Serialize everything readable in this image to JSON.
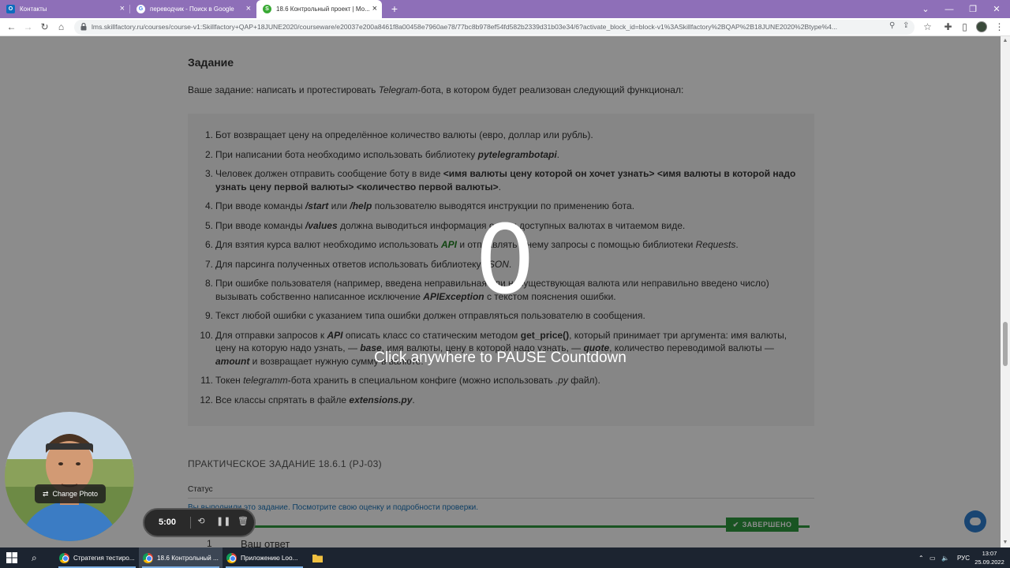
{
  "browser": {
    "tabs": [
      {
        "label": "Контакты",
        "icon": "outlook-icon"
      },
      {
        "label": "переводчик - Поиск в Google",
        "icon": "google-icon"
      },
      {
        "label": "18.6 Контрольный проект | Мо...",
        "icon": "skillfactory-icon"
      }
    ],
    "new_tab_label": "+",
    "url": "lms.skillfactory.ru/courses/course-v1:Skillfactory+QAP+18JUNE2020/courseware/e20037e200a8461f8a00458e7960ae78/77bc8b978ef54fd582b2339d31b03e34/6?activate_block_id=block-v1%3ASkillfactory%2BQAP%2B18JUNE2020%2Btype%4..."
  },
  "content": {
    "heading": "Задание",
    "intro_before": "Ваше задание: написать и протестировать ",
    "intro_italic": "Telegram",
    "intro_after": "-бота, в котором будет реализован следующий функционал:",
    "items": [
      {
        "num": "1.",
        "parts": [
          {
            "t": "Бот возвращает цену на определённое количество валюты (евро, доллар или рубль).",
            "s": ""
          }
        ]
      },
      {
        "num": "2.",
        "parts": [
          {
            "t": "При написании бота необходимо использовать библиотеку ",
            "s": ""
          },
          {
            "t": "pytelegrambotapi",
            "s": "bi"
          },
          {
            "t": ".",
            "s": ""
          }
        ]
      },
      {
        "num": "3.",
        "parts": [
          {
            "t": "Человек должен отправить сообщение боту в виде ",
            "s": ""
          },
          {
            "t": "<имя валюты цену которой он хочет узнать> <имя валюты в которой надо узнать цену первой валюты> <количество первой валюты>",
            "s": "b"
          },
          {
            "t": ".",
            "s": ""
          }
        ]
      },
      {
        "num": "4.",
        "parts": [
          {
            "t": "При вводе команды ",
            "s": ""
          },
          {
            "t": "/start",
            "s": "bi"
          },
          {
            "t": " или ",
            "s": ""
          },
          {
            "t": "/help",
            "s": "bi"
          },
          {
            "t": " пользователю выводятся инструкции по применению бота.",
            "s": ""
          }
        ]
      },
      {
        "num": "5.",
        "parts": [
          {
            "t": "При вводе команды ",
            "s": ""
          },
          {
            "t": "/values",
            "s": "bi"
          },
          {
            "t": " должна выводиться информация о всех доступных валютах в читаемом виде.",
            "s": ""
          }
        ]
      },
      {
        "num": "6.",
        "parts": [
          {
            "t": "Для взятия курса валют необходимо использовать ",
            "s": ""
          },
          {
            "t": "API",
            "s": "g"
          },
          {
            "t": " и отправлять к нему запросы с помощью библиотеки ",
            "s": ""
          },
          {
            "t": "Requests",
            "s": "it"
          },
          {
            "t": ".",
            "s": ""
          }
        ]
      },
      {
        "num": "7.",
        "parts": [
          {
            "t": "Для парсинга полученных ответов использовать библиотеку ",
            "s": ""
          },
          {
            "t": "JSON",
            "s": "it"
          },
          {
            "t": ".",
            "s": ""
          }
        ]
      },
      {
        "num": "8.",
        "parts": [
          {
            "t": "При ошибке пользователя (например, введена неправильная или несуществующая валюта или неправильно введено число) вызывать собственно написанное исключение ",
            "s": ""
          },
          {
            "t": "APIException",
            "s": "bi"
          },
          {
            "t": " с текстом пояснения ошибки.",
            "s": ""
          }
        ]
      },
      {
        "num": "9.",
        "parts": [
          {
            "t": "Текст любой ошибки с указанием типа ошибки должен отправляться пользователю в сообщения.",
            "s": ""
          }
        ]
      },
      {
        "num": "10.",
        "parts": [
          {
            "t": "Для отправки запросов к ",
            "s": ""
          },
          {
            "t": "API",
            "s": "bi"
          },
          {
            "t": " описать класс со статическим методом ",
            "s": ""
          },
          {
            "t": "get_price()",
            "s": "b"
          },
          {
            "t": ", который принимает три аргумента: имя валюты, цену на которую надо узнать, — ",
            "s": ""
          },
          {
            "t": "base",
            "s": "bi"
          },
          {
            "t": ", имя валюты, цену в которой надо узнать, — ",
            "s": ""
          },
          {
            "t": "quote",
            "s": "bi"
          },
          {
            "t": ", количество переводимой валюты — ",
            "s": ""
          },
          {
            "t": "amount",
            "s": "bi"
          },
          {
            "t": " и возвращает нужную сумму в валюте.",
            "s": ""
          }
        ]
      },
      {
        "num": "11.",
        "parts": [
          {
            "t": "Токен ",
            "s": ""
          },
          {
            "t": "telegramm",
            "s": "it"
          },
          {
            "t": "-бота хранить в специальном конфиге (можно использовать ",
            "s": ""
          },
          {
            "t": ".py",
            "s": "it"
          },
          {
            "t": " файл).",
            "s": ""
          }
        ]
      },
      {
        "num": "12.",
        "parts": [
          {
            "t": "Все классы спрятать в файле ",
            "s": ""
          },
          {
            "t": "extensions.py",
            "s": "bi"
          },
          {
            "t": ".",
            "s": ""
          }
        ]
      }
    ],
    "practical_title": "ПРАКТИЧЕСКОЕ ЗАДАНИЕ 18.6.1 (PJ-03)",
    "status_label": "Статус",
    "status_text": "Вы выполнили это задание. Посмотрите свою оценку и подробности проверки.",
    "done_badge": "ЗАВЕРШЕНО",
    "answer_num": "1",
    "answer_title": "Ваш ответ"
  },
  "overlay": {
    "countdown": "0",
    "hint": "Click anywhere to PAUSE Countdown"
  },
  "recorder": {
    "change_photo": "Change Photo",
    "timer": "5:00",
    "controls": [
      "undo-icon",
      "pause-icon",
      "trash-icon"
    ]
  },
  "taskbar": {
    "apps": [
      {
        "label": "Стратегия тестиро..."
      },
      {
        "label": "18.6 Контрольный ..."
      },
      {
        "label": "Приложению Loo..."
      }
    ],
    "lang": "РУС",
    "time": "13:07",
    "date": "25.09.2022"
  },
  "colors": {
    "tab_strip": "#8e6fb8",
    "done_green": "#2e9a3e",
    "link_blue": "#1a73b8",
    "taskbar": "#1c2430"
  }
}
